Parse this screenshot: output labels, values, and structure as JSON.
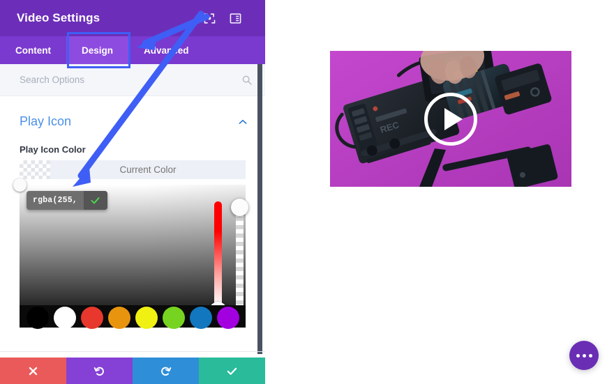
{
  "panel": {
    "header": {
      "title": "Video Settings",
      "icons": [
        {
          "name": "focus-expand-icon",
          "label": "Expand"
        },
        {
          "name": "layout-panel-icon",
          "label": "Layout"
        }
      ]
    },
    "tabs": [
      {
        "label": "Content",
        "active": false
      },
      {
        "label": "Design",
        "active": true
      },
      {
        "label": "Advanced",
        "active": false
      }
    ],
    "search": {
      "placeholder": "Search Options",
      "value": ""
    },
    "section": {
      "title": "Play Icon",
      "collapse_icon": "chevron-up-icon"
    },
    "field": {
      "label": "Play Icon Color",
      "current_color_placeholder": "Current Color",
      "current_color_value": ""
    },
    "color_picker": {
      "tooltip_text": "rgba(255,",
      "confirm_icon": "check-icon",
      "hue_value": "0",
      "alpha_value": "100",
      "swatches": [
        {
          "name": "black",
          "hex": "#000000"
        },
        {
          "name": "white",
          "hex": "#FFFFFF"
        },
        {
          "name": "red",
          "hex": "#E8372C"
        },
        {
          "name": "orange",
          "hex": "#E8940F"
        },
        {
          "name": "yellow",
          "hex": "#F0F012"
        },
        {
          "name": "green",
          "hex": "#76D420"
        },
        {
          "name": "blue",
          "hex": "#1277BE"
        },
        {
          "name": "purple",
          "hex": "#A300E0"
        }
      ]
    },
    "actions": [
      {
        "name": "close",
        "icon": "close-icon",
        "color": "#EB5A5A"
      },
      {
        "name": "undo",
        "icon": "undo-icon",
        "color": "#8540D6"
      },
      {
        "name": "redo",
        "icon": "redo-icon",
        "color": "#2E8FD8"
      },
      {
        "name": "save",
        "icon": "check-icon",
        "color": "#2ABB9B"
      }
    ]
  },
  "preview": {
    "video": {
      "play_button_label": "Play",
      "background_color": "#B93FC4"
    },
    "fab": {
      "label": "More options",
      "color": "#6A2EB5"
    }
  },
  "colors": {
    "header_purple": "#6C2EB9",
    "tabbar_purple": "#7A39CF",
    "active_tab_purple": "#8E4BE0",
    "section_blue": "#4C8FE8",
    "annotation_blue": "#3F5EF5"
  }
}
